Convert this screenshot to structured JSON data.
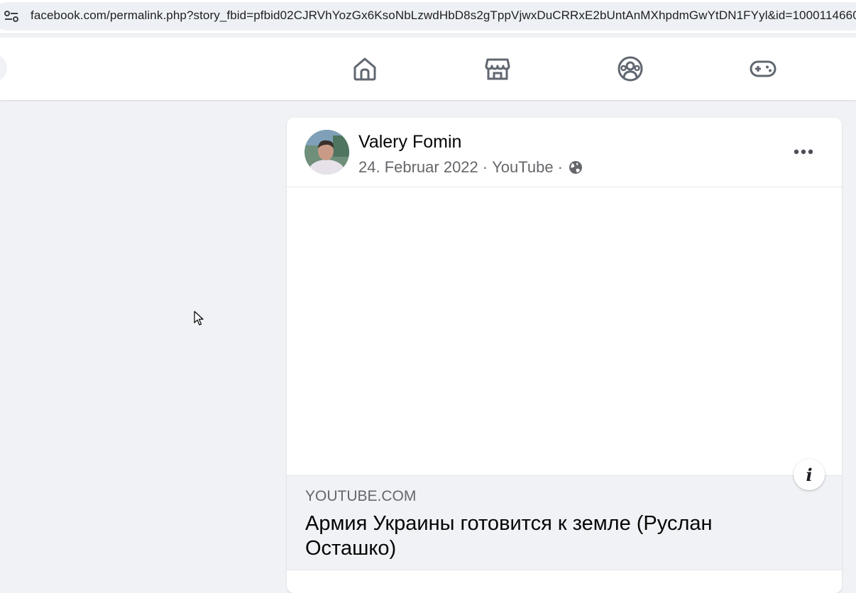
{
  "browser": {
    "url": "facebook.com/permalink.php?story_fbid=pfbid02CJRVhYozGx6KsoNbLzwdHbD8s2gTppVjwxDuCRRxE2bUntAnMXhpdmGwYtDN1FYyl&id=1000114660"
  },
  "nav": {
    "tabs": [
      {
        "icon": "home-icon"
      },
      {
        "icon": "marketplace-icon"
      },
      {
        "icon": "groups-icon"
      },
      {
        "icon": "gaming-icon"
      }
    ]
  },
  "post": {
    "author": "Valery Fomin",
    "date": "24. Februar 2022",
    "source": "YouTube",
    "separator": "·",
    "audience_icon": "globe-icon",
    "more_icon": "more-options-icon",
    "link": {
      "domain": "YOUTUBE.COM",
      "title": "Армия Украины готовится к земле (Руслан Осташко)"
    },
    "info_label": "i"
  }
}
